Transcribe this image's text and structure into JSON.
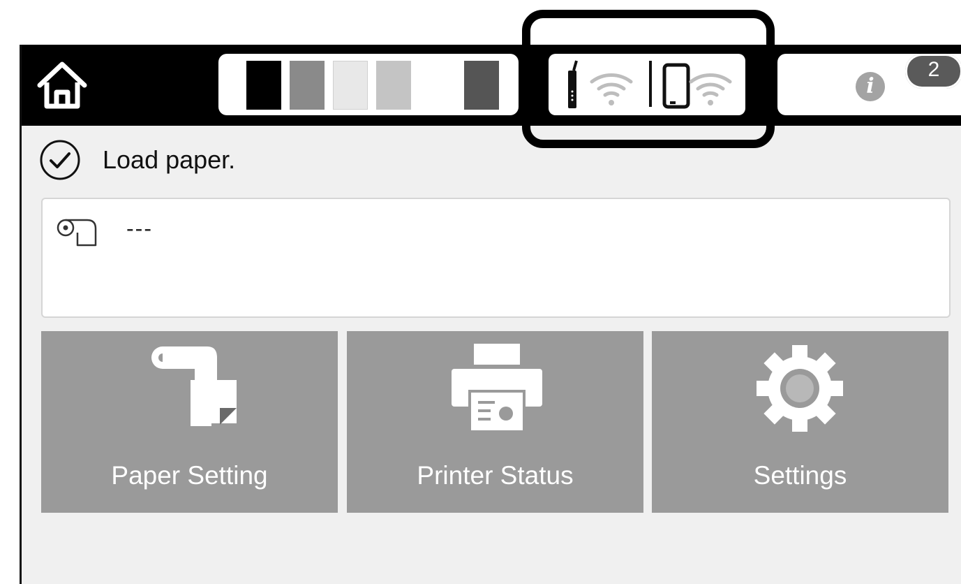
{
  "header": {
    "home_icon": "home-icon",
    "ink_colors": [
      "#000000",
      "#8a8a8a",
      "#e8e8e8",
      "#c4c4c4",
      "#555555"
    ],
    "network_icons": [
      "wifi-router-icon",
      "wifi-direct-icon"
    ],
    "info_icon": "i",
    "notification_count": "2"
  },
  "status": {
    "icon": "check-circle-icon",
    "message": "Load paper."
  },
  "paper_source": {
    "icon": "roll-paper-icon",
    "value": "---"
  },
  "menu": {
    "tiles": [
      {
        "label": "Paper Setting",
        "icon": "paper-setting-icon"
      },
      {
        "label": "Printer Status",
        "icon": "printer-icon"
      },
      {
        "label": "Settings",
        "icon": "gear-icon"
      }
    ]
  }
}
